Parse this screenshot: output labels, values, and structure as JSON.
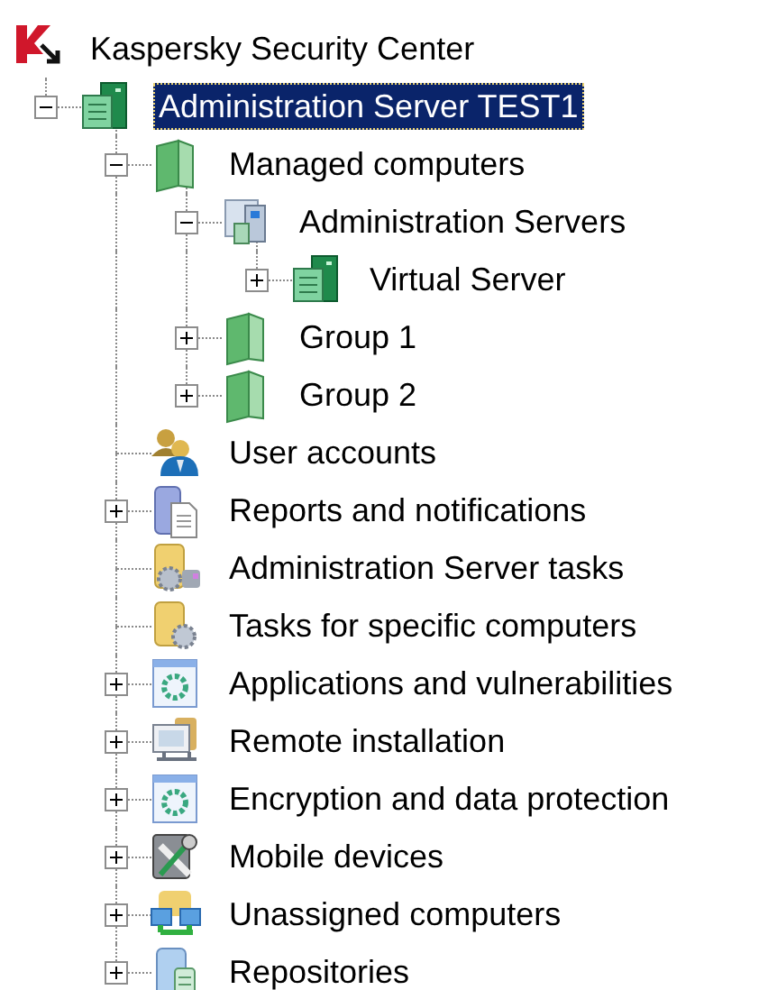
{
  "tree": {
    "label": "Kaspersky Security Center",
    "kind": "logo",
    "selected": false,
    "children": [
      {
        "label": "Administration Server TEST1",
        "kind": "server",
        "selected": true,
        "expanded": true,
        "children": [
          {
            "label": "Managed computers",
            "kind": "folder",
            "selected": false,
            "expanded": true,
            "children": [
              {
                "label": "Administration Servers",
                "kind": "servers",
                "selected": false,
                "expanded": true,
                "children": [
                  {
                    "label": "Virtual Server",
                    "kind": "server",
                    "selected": false,
                    "expanded": false
                  }
                ]
              },
              {
                "label": "Group 1",
                "kind": "folder",
                "selected": false,
                "expanded": false
              },
              {
                "label": "Group 2",
                "kind": "folder",
                "selected": false,
                "expanded": false
              }
            ]
          },
          {
            "label": "User accounts",
            "kind": "users",
            "selected": false
          },
          {
            "label": "Reports and notifications",
            "kind": "reports",
            "selected": false,
            "expanded": false
          },
          {
            "label": "Administration Server tasks",
            "kind": "tasks",
            "selected": false
          },
          {
            "label": "Tasks for specific computers",
            "kind": "tasks2",
            "selected": false
          },
          {
            "label": "Applications and vulnerabilities",
            "kind": "apps",
            "selected": false,
            "expanded": false
          },
          {
            "label": "Remote installation",
            "kind": "remote",
            "selected": false,
            "expanded": false
          },
          {
            "label": "Encryption and data protection",
            "kind": "apps",
            "selected": false,
            "expanded": false
          },
          {
            "label": "Mobile devices",
            "kind": "mobile",
            "selected": false,
            "expanded": false
          },
          {
            "label": "Unassigned computers",
            "kind": "unassigned",
            "selected": false,
            "expanded": false
          },
          {
            "label": "Repositories",
            "kind": "repository",
            "selected": false,
            "expanded": false
          }
        ]
      }
    ]
  }
}
